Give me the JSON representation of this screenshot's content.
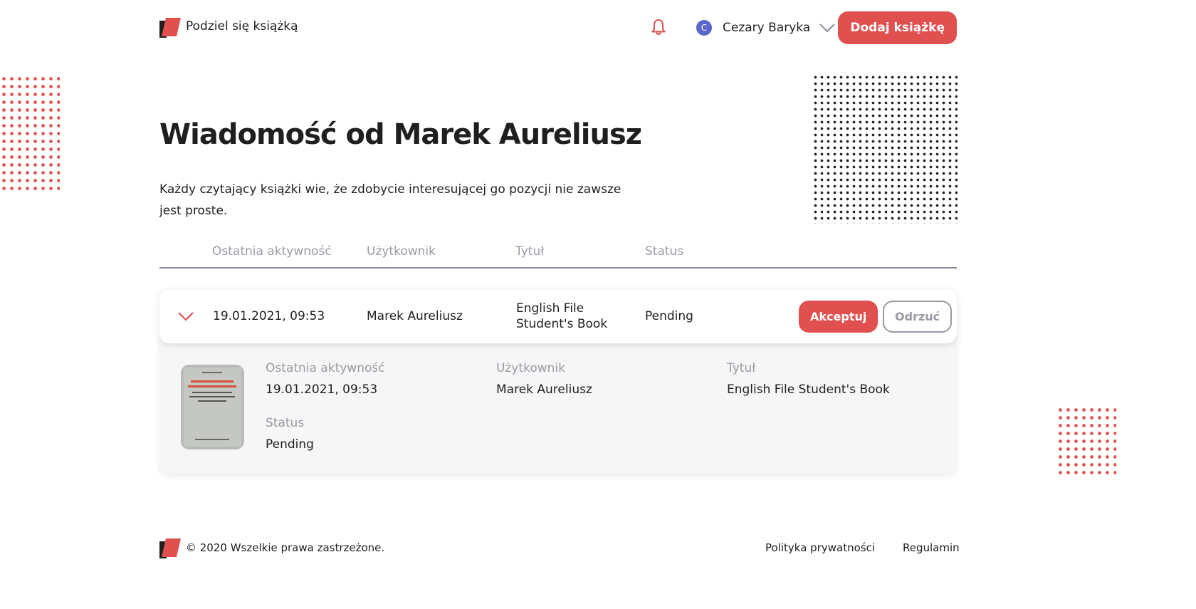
{
  "header": {
    "brand": "Podziel się książką",
    "user": {
      "initial": "C",
      "name": "Cezary Baryka"
    },
    "add_button": "Dodaj książkę"
  },
  "hero": {
    "title": "Wiadomość od Marek Aureliusz",
    "description": "Każdy czytający książki wie, że zdobycie interesującej go pozycji nie zawsze jest proste."
  },
  "table": {
    "columns": [
      "Ostatnia aktywność",
      "Użytkownik",
      "Tytuł",
      "Status"
    ],
    "row": {
      "date": "19.01.2021, 09:53",
      "user": "Marek Aureliusz",
      "title_line1": "English File",
      "title_line2": "Student's Book",
      "status": "Pending",
      "accept": "Akceptuj",
      "reject": "Odrzuć"
    }
  },
  "detail": {
    "labels": {
      "activity": "Ostatnia aktywność",
      "user": "Użytkownik",
      "title": "Tytuł",
      "status": "Status"
    },
    "values": {
      "activity": "19.01.2021, 09:53",
      "user": "Marek Aureliusz",
      "title": "English File Student's Book",
      "status": "Pending"
    },
    "cover_alt": "book-cover"
  },
  "footer": {
    "copyright": "© 2020 Wszelkie prawa zastrzeżone.",
    "privacy": "Polityka prywatności",
    "terms": "Regulamin"
  },
  "colors": {
    "accent": "#e0504e",
    "muted": "#9a9aa6",
    "avatar": "#5b66c9"
  },
  "icons": [
    "logo-icon",
    "bell-icon",
    "chevron-down-icon",
    "expand-chevron-icon"
  ]
}
